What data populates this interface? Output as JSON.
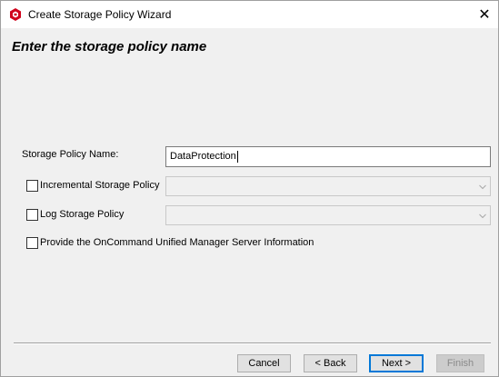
{
  "window": {
    "title": "Create Storage Policy Wizard",
    "close_symbol": "✕",
    "app_icon": "netapp-icon",
    "accent_color": "#d0021b"
  },
  "page": {
    "heading": "Enter the storage policy name"
  },
  "form": {
    "policy_name_label": "Storage Policy Name:",
    "policy_name_value": "DataProtection",
    "incremental_label": "Incremental Storage Policy",
    "incremental_checked": false,
    "incremental_value": "",
    "log_label": "Log Storage Policy",
    "log_checked": false,
    "log_value": "",
    "oncommand_label": "Provide the OnCommand Unified Manager Server Information",
    "oncommand_checked": false
  },
  "buttons": {
    "cancel": "Cancel",
    "back": "< Back",
    "next": "Next >",
    "finish": "Finish"
  }
}
